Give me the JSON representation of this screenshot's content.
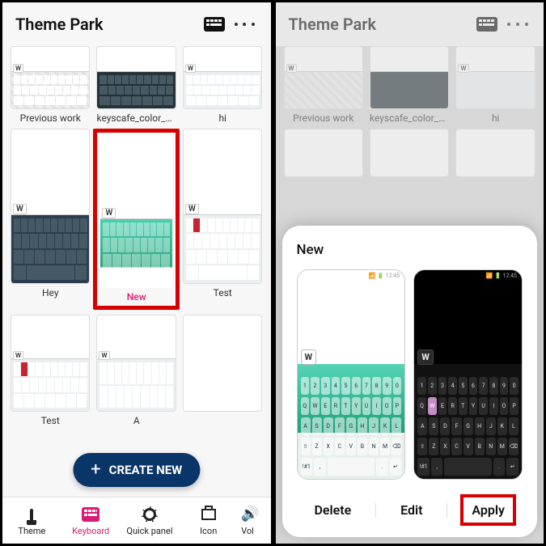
{
  "app": {
    "title": "Theme Park"
  },
  "themes_row1": [
    {
      "label": "Previous work"
    },
    {
      "label": "keyscafe_color_preset"
    },
    {
      "label": "hi"
    }
  ],
  "themes_row2": [
    {
      "label": "Hey"
    },
    {
      "label": "New"
    },
    {
      "label": "Test"
    }
  ],
  "themes_row3": [
    {
      "label": "Test"
    },
    {
      "label": "A"
    },
    {
      "label": ""
    }
  ],
  "fab": {
    "label": "CREATE NEW"
  },
  "tabs": [
    {
      "label": "Theme"
    },
    {
      "label": "Keyboard"
    },
    {
      "label": "Quick panel"
    },
    {
      "label": "Icon"
    },
    {
      "label": "Vol"
    }
  ],
  "sheet": {
    "title": "New",
    "actions": {
      "delete": "Delete",
      "edit": "Edit",
      "apply": "Apply"
    }
  },
  "key_preview": "W"
}
